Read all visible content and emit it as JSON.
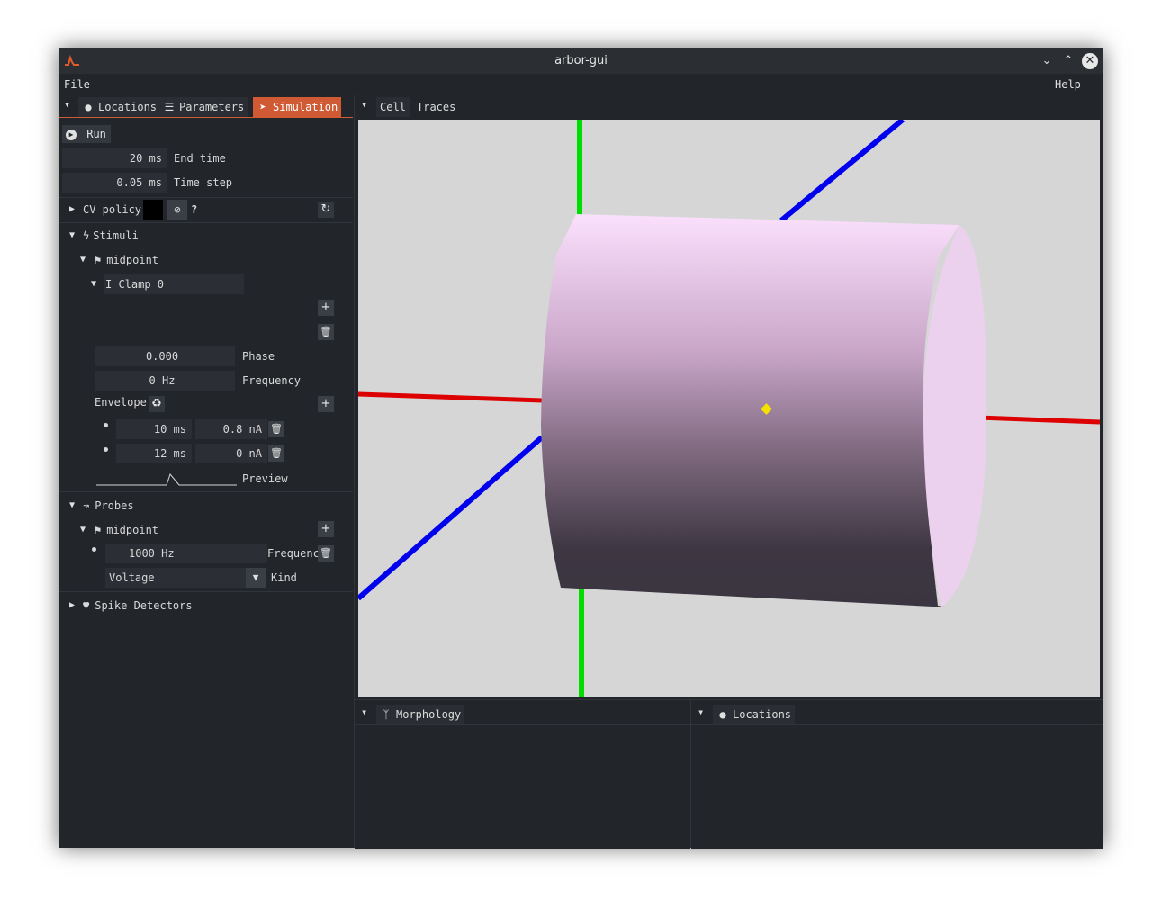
{
  "window": {
    "title": "arbor-gui"
  },
  "menu": {
    "file": "File",
    "help": "Help"
  },
  "left_tabs": [
    {
      "label": "Locations",
      "icon": "map-marker-icon"
    },
    {
      "label": "Parameters",
      "icon": "list-icon"
    },
    {
      "label": "Simulation",
      "icon": "rocket-icon",
      "active": true
    }
  ],
  "right_tabs": [
    {
      "label": "Cell"
    },
    {
      "label": "Traces"
    }
  ],
  "simulation": {
    "run_label": "Run",
    "end_time": {
      "value": "20 ms",
      "label": "End time"
    },
    "time_step": {
      "value": "0.05 ms",
      "label": "Time step"
    },
    "cv_policy_label": "CV policy",
    "cv_help": "?",
    "stimuli": {
      "label": "Stimuli",
      "locset": "midpoint",
      "clamp": {
        "label": "I Clamp 0",
        "phase": {
          "value": "0.000",
          "label": "Phase"
        },
        "frequency": {
          "value": "0 Hz",
          "label": "Frequency"
        },
        "envelope_label": "Envelope",
        "envelope": [
          {
            "time": "10 ms",
            "amp": "0.8 nA"
          },
          {
            "time": "12 ms",
            "amp": "0 nA"
          }
        ],
        "preview_label": "Preview"
      }
    },
    "probes": {
      "label": "Probes",
      "locset": "midpoint",
      "frequency": {
        "value": "1000 Hz",
        "label": "Frequenc"
      },
      "kind": {
        "value": "Voltage",
        "label": "Kind"
      }
    },
    "spike_detectors": {
      "label": "Spike Detectors"
    }
  },
  "bottom_tabs": {
    "morphology": "Morphology",
    "locations": "Locations"
  },
  "colors": {
    "accent": "#cf5a33",
    "axis_x": "#dd0000",
    "axis_y": "#00dd00",
    "axis_z": "#0000ee",
    "cell_light": "#f7d8f8",
    "cell_dark": "#3a3540",
    "marker": "#f5e000"
  }
}
